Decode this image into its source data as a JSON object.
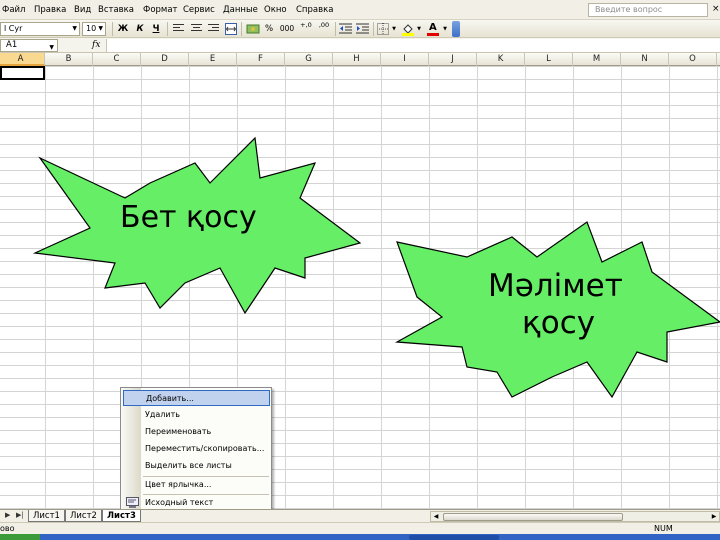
{
  "menu": {
    "items": [
      "Файл",
      "Правка",
      "Вид",
      "Вставка",
      "Формат",
      "Сервис",
      "Данные",
      "Окно",
      "Справка"
    ],
    "ask_placeholder": "Введите вопрос",
    "close_glyph": "×"
  },
  "toolbar": {
    "font_name": "Arial Cyr",
    "font_name_visible": "l Cyr",
    "font_size": "10",
    "bold": "Ж",
    "italic": "К",
    "underline": "Ч",
    "percent": "%",
    "thousands": "000",
    "inc_decimal": "+,0",
    "dec_decimal": ",00",
    "font_color_letter": "A"
  },
  "formula_bar": {
    "cell_ref": "A1",
    "fx": "fx",
    "value": ""
  },
  "columns": [
    "A",
    "B",
    "C",
    "D",
    "E",
    "F",
    "G",
    "H",
    "I",
    "J",
    "K",
    "L",
    "M",
    "N",
    "O"
  ],
  "selected_column": "A",
  "shapes": {
    "burst1": {
      "text": "Бет қосу",
      "fill": "#66ee66"
    },
    "burst2": {
      "line1": "Мәлімет",
      "line2": "қосу",
      "fill": "#66ee66"
    }
  },
  "context_menu": {
    "items": [
      {
        "label": "Добавить...",
        "highlighted": true
      },
      {
        "label": "Удалить"
      },
      {
        "label": "Переименовать"
      },
      {
        "label": "Переместить/скопировать..."
      },
      {
        "label": "Выделить все листы"
      },
      {
        "label": "Цвет ярлычка..."
      },
      {
        "label": "Исходный текст",
        "icon": "view-code-icon"
      }
    ]
  },
  "sheet_tabs": {
    "tabs": [
      "Лист1",
      "Лист2",
      "Лист3"
    ],
    "active": "Лист3"
  },
  "status": {
    "ready": "ово",
    "num": "NUM"
  },
  "colors": {
    "starburst_fill": "#66ee66",
    "menu_highlight": "#c1d2ee",
    "column_selected": "#f9d890",
    "taskbar": "#3163c5"
  }
}
